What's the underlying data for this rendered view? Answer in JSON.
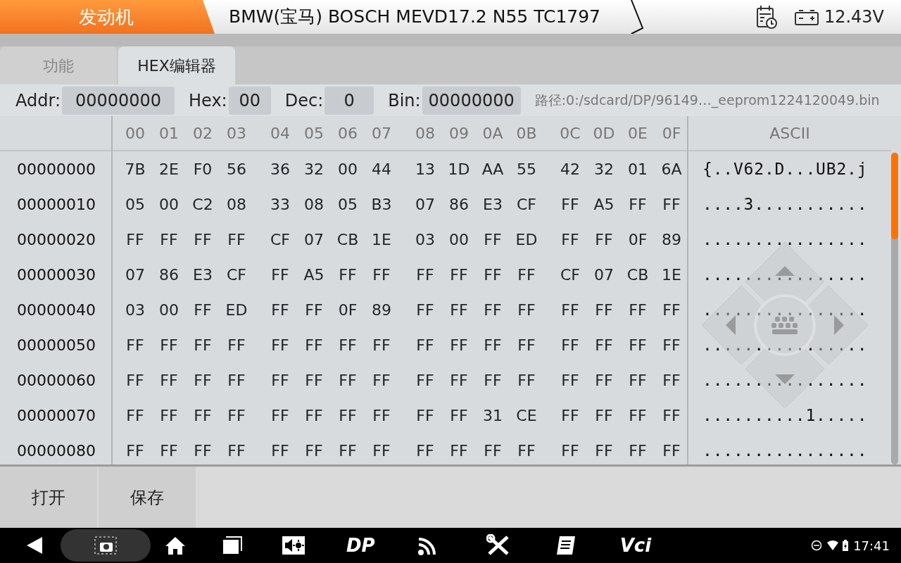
{
  "header": {
    "section": "发动机",
    "vehicle": "BMW(宝马) BOSCH MEVD17.2 N55 TC1797",
    "voltage": "12.43V"
  },
  "tabs": [
    {
      "label": "功能",
      "selected": false
    },
    {
      "label": "HEX编辑器",
      "selected": true
    }
  ],
  "fields": [
    {
      "label": "Addr:",
      "value": "00000000"
    },
    {
      "label": "Hex:",
      "value": "00"
    },
    {
      "label": "Dec:",
      "value": "0"
    },
    {
      "label": "Bin:",
      "value": "00000000"
    }
  ],
  "path": "路径:0:/sdcard/DP/96149…_eeprom1224120049.bin",
  "table": {
    "columns": [
      "00",
      "01",
      "02",
      "03",
      "04",
      "05",
      "06",
      "07",
      "08",
      "09",
      "0A",
      "0B",
      "0C",
      "0D",
      "0E",
      "0F"
    ],
    "ascii_heading": "ASCII",
    "rows": [
      {
        "address": "00000000",
        "bytes": [
          "7B",
          "2E",
          "F0",
          "56",
          "36",
          "32",
          "00",
          "44",
          "13",
          "1D",
          "AA",
          "55",
          "42",
          "32",
          "01",
          "6A"
        ],
        "ascii": "{..V62.D...UB2.j"
      },
      {
        "address": "00000010",
        "bytes": [
          "05",
          "00",
          "C2",
          "08",
          "33",
          "08",
          "05",
          "B3",
          "07",
          "86",
          "E3",
          "CF",
          "FF",
          "A5",
          "FF",
          "FF"
        ],
        "ascii": "....3..........."
      },
      {
        "address": "00000020",
        "bytes": [
          "FF",
          "FF",
          "FF",
          "FF",
          "CF",
          "07",
          "CB",
          "1E",
          "03",
          "00",
          "FF",
          "ED",
          "FF",
          "FF",
          "0F",
          "89"
        ],
        "ascii": "................"
      },
      {
        "address": "00000030",
        "bytes": [
          "07",
          "86",
          "E3",
          "CF",
          "FF",
          "A5",
          "FF",
          "FF",
          "FF",
          "FF",
          "FF",
          "FF",
          "CF",
          "07",
          "CB",
          "1E"
        ],
        "ascii": "................"
      },
      {
        "address": "00000040",
        "bytes": [
          "03",
          "00",
          "FF",
          "ED",
          "FF",
          "FF",
          "0F",
          "89",
          "FF",
          "FF",
          "FF",
          "FF",
          "FF",
          "FF",
          "FF",
          "FF"
        ],
        "ascii": "................"
      },
      {
        "address": "00000050",
        "bytes": [
          "FF",
          "FF",
          "FF",
          "FF",
          "FF",
          "FF",
          "FF",
          "FF",
          "FF",
          "FF",
          "FF",
          "FF",
          "FF",
          "FF",
          "FF",
          "FF"
        ],
        "ascii": "................"
      },
      {
        "address": "00000060",
        "bytes": [
          "FF",
          "FF",
          "FF",
          "FF",
          "FF",
          "FF",
          "FF",
          "FF",
          "FF",
          "FF",
          "FF",
          "FF",
          "FF",
          "FF",
          "FF",
          "FF"
        ],
        "ascii": "................"
      },
      {
        "address": "00000070",
        "bytes": [
          "FF",
          "FF",
          "FF",
          "FF",
          "FF",
          "FF",
          "FF",
          "FF",
          "FF",
          "FF",
          "31",
          "CE",
          "FF",
          "FF",
          "FF",
          "FF"
        ],
        "ascii": "..........1....."
      },
      {
        "address": "00000080",
        "bytes": [
          "FF",
          "FF",
          "FF",
          "FF",
          "FF",
          "FF",
          "FF",
          "FF",
          "FF",
          "FF",
          "FF",
          "FF",
          "FF",
          "FF",
          "FF",
          "FF"
        ],
        "ascii": "................"
      }
    ]
  },
  "buttons": [
    "打开",
    "保存"
  ],
  "navbar": {
    "apps": [
      "DP",
      "Vci"
    ],
    "time": "17:41"
  }
}
